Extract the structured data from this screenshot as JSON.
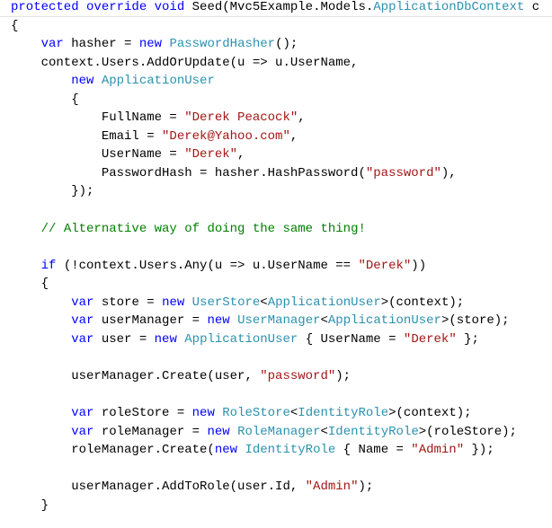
{
  "colors": {
    "keyword": "#0000ff",
    "type": "#2b91af",
    "string": "#a31515",
    "comment": "#008000",
    "plain": "#000000"
  },
  "code_lines": [
    [
      [
        "k",
        "protected override void "
      ],
      [
        "p",
        "Seed(Mvc5Example.Models."
      ],
      [
        "t",
        "ApplicationDbContext"
      ],
      [
        "p",
        " c"
      ]
    ],
    [
      [
        "p",
        "{"
      ]
    ],
    [
      [
        "p",
        "    "
      ],
      [
        "k",
        "var"
      ],
      [
        "p",
        " hasher = "
      ],
      [
        "k",
        "new "
      ],
      [
        "t",
        "PasswordHasher"
      ],
      [
        "p",
        "();"
      ]
    ],
    [
      [
        "p",
        "    context.Users.AddOrUpdate(u => u.UserName,"
      ]
    ],
    [
      [
        "p",
        "        "
      ],
      [
        "k",
        "new "
      ],
      [
        "t",
        "ApplicationUser"
      ]
    ],
    [
      [
        "p",
        "        {"
      ]
    ],
    [
      [
        "p",
        "            FullName = "
      ],
      [
        "s",
        "\"Derek Peacock\""
      ],
      [
        "p",
        ","
      ]
    ],
    [
      [
        "p",
        "            Email = "
      ],
      [
        "s",
        "\"Derek@Yahoo.com\""
      ],
      [
        "p",
        ","
      ]
    ],
    [
      [
        "p",
        "            UserName = "
      ],
      [
        "s",
        "\"Derek\""
      ],
      [
        "p",
        ","
      ]
    ],
    [
      [
        "p",
        "            PasswordHash = hasher.HashPassword("
      ],
      [
        "s",
        "\"password\""
      ],
      [
        "p",
        "),"
      ]
    ],
    [
      [
        "p",
        "        });"
      ]
    ],
    [],
    [
      [
        "p",
        "    "
      ],
      [
        "c",
        "// Alternative way of doing the same thing!"
      ]
    ],
    [],
    [
      [
        "p",
        "    "
      ],
      [
        "k",
        "if"
      ],
      [
        "p",
        " (!context.Users.Any(u => u.UserName == "
      ],
      [
        "s",
        "\"Derek\""
      ],
      [
        "p",
        "))"
      ]
    ],
    [
      [
        "p",
        "    {"
      ]
    ],
    [
      [
        "p",
        "        "
      ],
      [
        "k",
        "var"
      ],
      [
        "p",
        " store = "
      ],
      [
        "k",
        "new "
      ],
      [
        "t",
        "UserStore"
      ],
      [
        "p",
        "<"
      ],
      [
        "t",
        "ApplicationUser"
      ],
      [
        "p",
        ">(context);"
      ]
    ],
    [
      [
        "p",
        "        "
      ],
      [
        "k",
        "var"
      ],
      [
        "p",
        " userManager = "
      ],
      [
        "k",
        "new "
      ],
      [
        "t",
        "UserManager"
      ],
      [
        "p",
        "<"
      ],
      [
        "t",
        "ApplicationUser"
      ],
      [
        "p",
        ">(store);"
      ]
    ],
    [
      [
        "p",
        "        "
      ],
      [
        "k",
        "var"
      ],
      [
        "p",
        " user = "
      ],
      [
        "k",
        "new "
      ],
      [
        "t",
        "ApplicationUser"
      ],
      [
        "p",
        " { UserName = "
      ],
      [
        "s",
        "\"Derek\""
      ],
      [
        "p",
        " };"
      ]
    ],
    [],
    [
      [
        "p",
        "        userManager.Create(user, "
      ],
      [
        "s",
        "\"password\""
      ],
      [
        "p",
        ");"
      ]
    ],
    [],
    [
      [
        "p",
        "        "
      ],
      [
        "k",
        "var"
      ],
      [
        "p",
        " roleStore = "
      ],
      [
        "k",
        "new "
      ],
      [
        "t",
        "RoleStore"
      ],
      [
        "p",
        "<"
      ],
      [
        "t",
        "IdentityRole"
      ],
      [
        "p",
        ">(context);"
      ]
    ],
    [
      [
        "p",
        "        "
      ],
      [
        "k",
        "var"
      ],
      [
        "p",
        " roleManager = "
      ],
      [
        "k",
        "new "
      ],
      [
        "t",
        "RoleManager"
      ],
      [
        "p",
        "<"
      ],
      [
        "t",
        "IdentityRole"
      ],
      [
        "p",
        ">(roleStore);"
      ]
    ],
    [
      [
        "p",
        "        roleManager.Create("
      ],
      [
        "k",
        "new "
      ],
      [
        "t",
        "IdentityRole"
      ],
      [
        "p",
        " { Name = "
      ],
      [
        "s",
        "\"Admin\""
      ],
      [
        "p",
        " });"
      ]
    ],
    [],
    [
      [
        "p",
        "        userManager.AddToRole(user.Id, "
      ],
      [
        "s",
        "\"Admin\""
      ],
      [
        "p",
        ");"
      ]
    ],
    [
      [
        "p",
        "    }"
      ]
    ]
  ]
}
